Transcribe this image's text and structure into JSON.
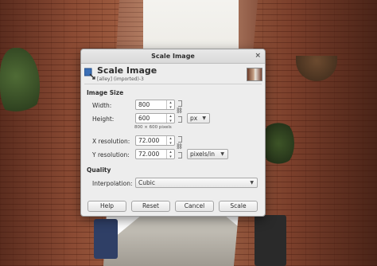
{
  "window": {
    "title": "Scale Image",
    "close_glyph": "×"
  },
  "header": {
    "title": "Scale Image",
    "subtitle": "[alley] (imported)-3",
    "icon": "scale-image-icon"
  },
  "image_size": {
    "section_label": "Image Size",
    "width_label": "Width:",
    "width_value": "800",
    "height_label": "Height:",
    "height_value": "600",
    "pixels_hint": "800 × 600 pixels",
    "unit": "px",
    "x_res_label": "X resolution:",
    "x_res_value": "72.000",
    "y_res_label": "Y resolution:",
    "y_res_value": "72.000",
    "res_unit": "pixels/in"
  },
  "quality": {
    "section_label": "Quality",
    "interp_label": "Interpolation:",
    "interp_value": "Cubic"
  },
  "buttons": {
    "help": "Help",
    "reset": "Reset",
    "cancel": "Cancel",
    "scale": "Scale"
  },
  "icons": {
    "spin_up": "▴",
    "spin_down": "▾",
    "dropdown": "▼",
    "chain": "⛓"
  }
}
